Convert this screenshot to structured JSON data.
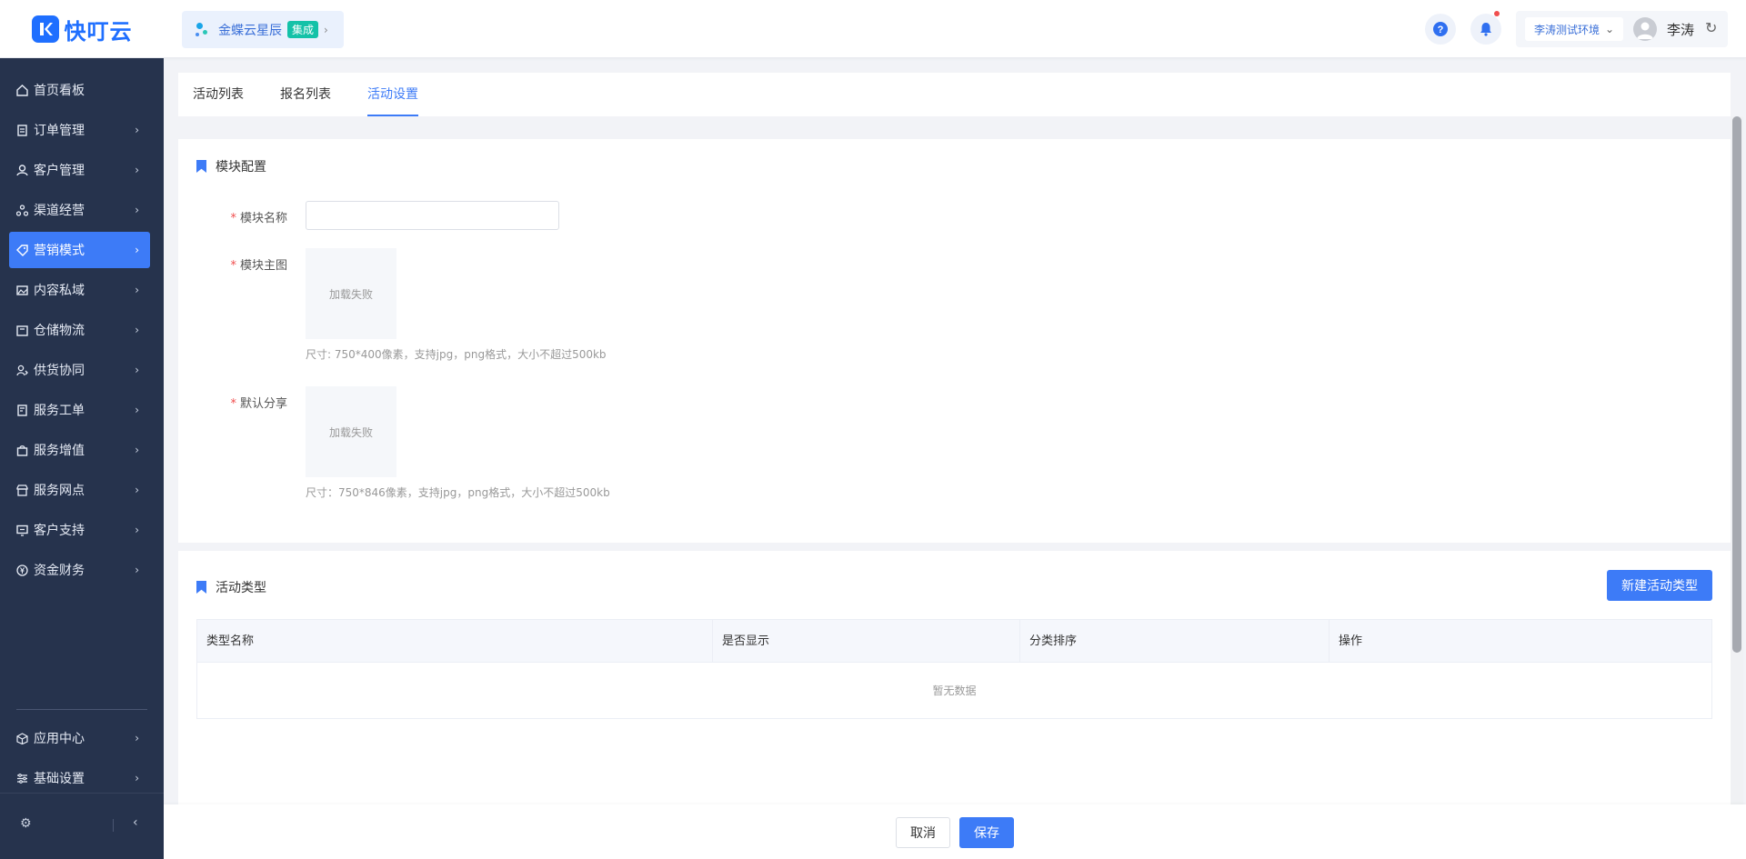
{
  "header": {
    "app_name": "快叮云",
    "brand": {
      "name": "金蝶云星辰",
      "badge": "集成"
    },
    "help_icon": "question-icon",
    "bell_icon": "bell-icon",
    "env_select": "李涛测试环境",
    "user_name": "李涛"
  },
  "sidebar": {
    "items": [
      {
        "label": "首页看板",
        "icon": "home-icon"
      },
      {
        "label": "订单管理",
        "icon": "order-icon"
      },
      {
        "label": "客户管理",
        "icon": "user-icon"
      },
      {
        "label": "渠道经营",
        "icon": "channel-icon"
      },
      {
        "label": "营销模式",
        "icon": "tag-icon"
      },
      {
        "label": "内容私域",
        "icon": "image-icon"
      },
      {
        "label": "仓储物流",
        "icon": "box-icon"
      },
      {
        "label": "供货协同",
        "icon": "supply-icon"
      },
      {
        "label": "服务工单",
        "icon": "ticket-icon"
      },
      {
        "label": "服务增值",
        "icon": "bag-icon"
      },
      {
        "label": "服务网点",
        "icon": "store-icon"
      },
      {
        "label": "客户支持",
        "icon": "support-icon"
      },
      {
        "label": "资金财务",
        "icon": "yen-icon"
      }
    ],
    "bottom_items": [
      {
        "label": "应用中心",
        "icon": "cube-icon"
      },
      {
        "label": "基础设置",
        "icon": "settings-icon"
      }
    ],
    "active_index": 4
  },
  "tabs": [
    {
      "label": "活动列表"
    },
    {
      "label": "报名列表"
    },
    {
      "label": "活动设置"
    }
  ],
  "module_config": {
    "title": "模块配置",
    "name_label": "模块名称",
    "name_value": "",
    "main_image_label": "模块主图",
    "main_image_status": "加载失败",
    "main_image_hint": "尺寸: 750*400像素，支持jpg，png格式，大小不超过500kb",
    "share_label": "默认分享",
    "share_image_status": "加载失败",
    "share_image_hint": "尺寸：750*846像素，支持jpg，png格式，大小不超过500kb"
  },
  "activity_type": {
    "title": "活动类型",
    "new_button": "新建活动类型",
    "columns": [
      "类型名称",
      "是否显示",
      "分类排序",
      "操作"
    ],
    "empty_text": "暂无数据"
  },
  "footer": {
    "cancel": "取消",
    "save": "保存"
  },
  "colors": {
    "primary": "#3d7bf7",
    "sidebar_bg": "#26334d",
    "required": "#f04e4e"
  }
}
